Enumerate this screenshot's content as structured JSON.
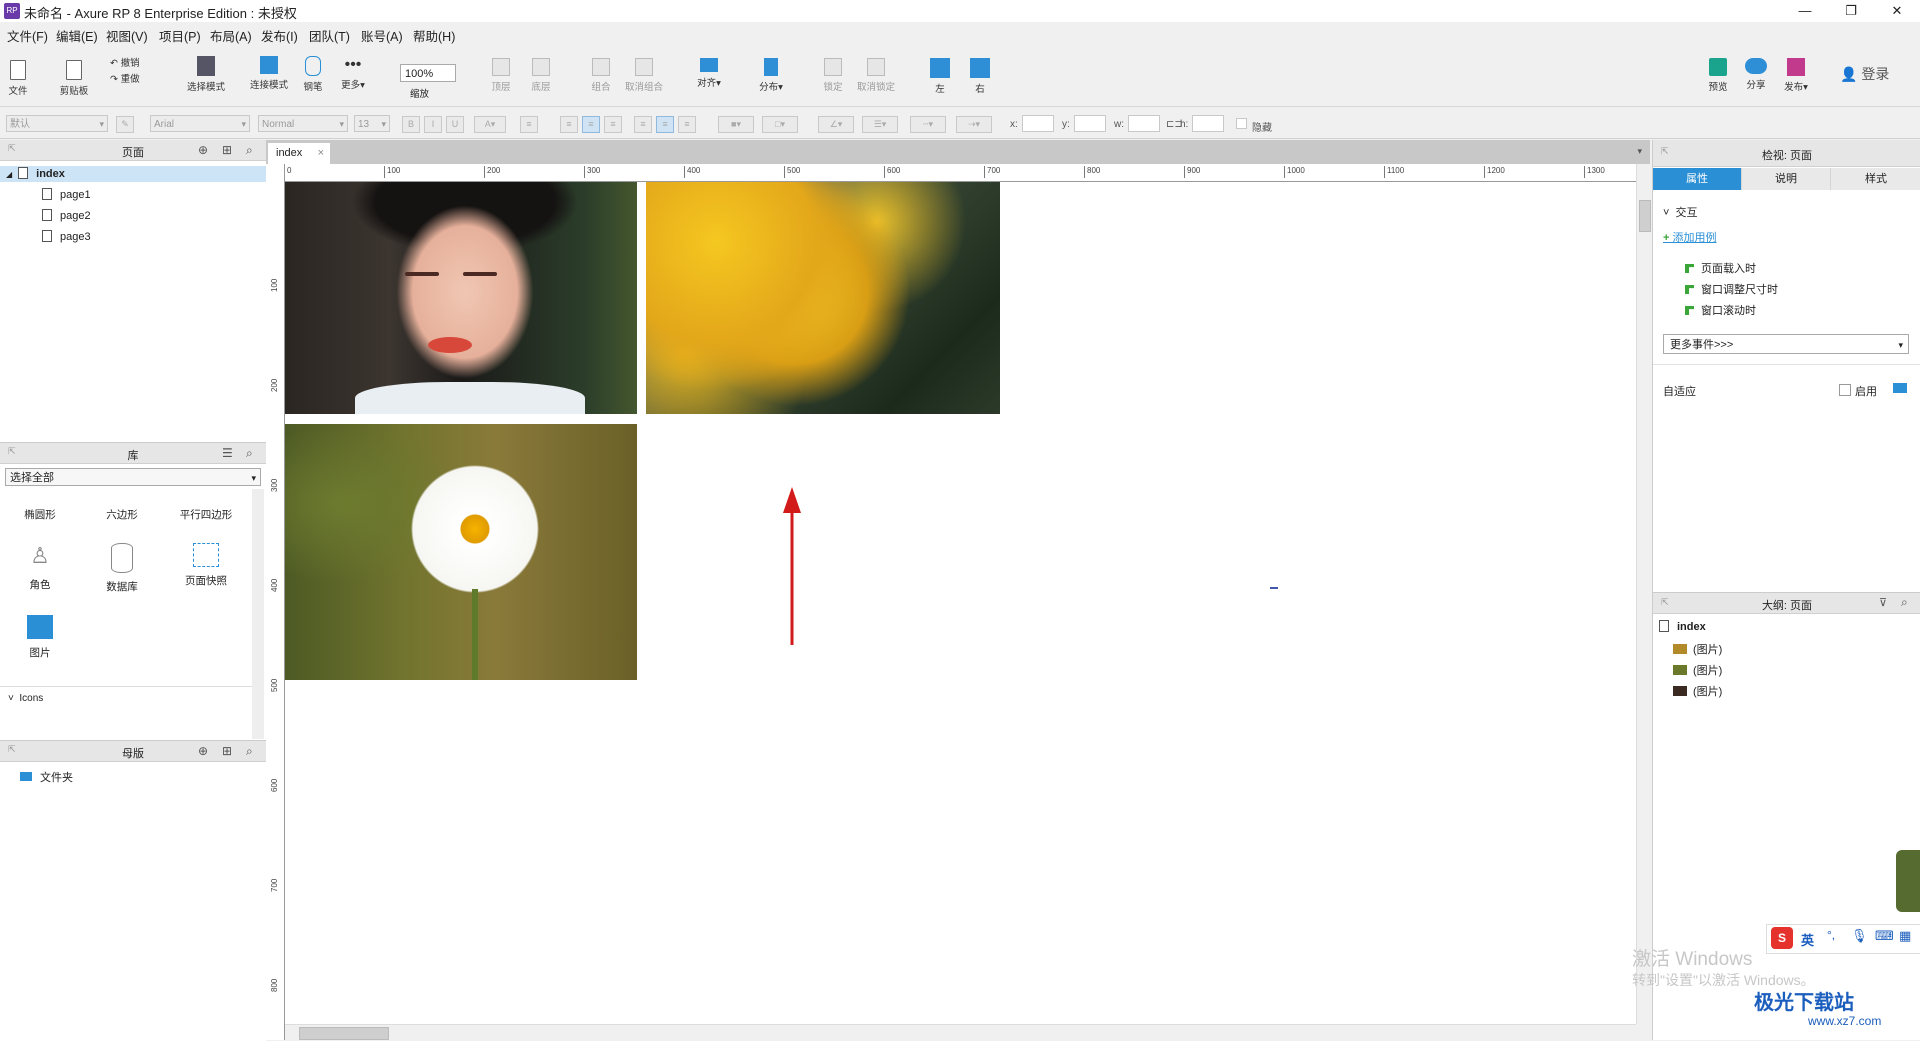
{
  "window": {
    "title": "未命名 - Axure RP 8 Enterprise Edition : 未授权",
    "app_icon": "RP"
  },
  "menu": [
    "文件(F)",
    "编辑(E)",
    "视图(V)",
    "项目(P)",
    "布局(A)",
    "发布(I)",
    "团队(T)",
    "账号(A)",
    "帮助(H)"
  ],
  "toolbar": {
    "file": "文件",
    "clipboard": "剪贴板",
    "undo": "撤销",
    "redo": "重做",
    "select_mode": "选择模式",
    "connect_mode": "连接模式",
    "pen": "钢笔",
    "more": "更多▾",
    "zoom_value": "100%",
    "zoom_label": "缩放",
    "top": "顶层",
    "bottom": "底层",
    "group": "组合",
    "ungroup": "取消组合",
    "align": "对齐▾",
    "distribute": "分布▾",
    "lock": "锁定",
    "unlock": "取消锁定",
    "left": "左",
    "right": "右",
    "preview": "预览",
    "share": "分享",
    "publish": "发布▾",
    "login": "登录"
  },
  "format": {
    "style": "默认",
    "font": "Arial",
    "weight": "Normal",
    "size": "13",
    "x_label": "x:",
    "y_label": "y:",
    "w_label": "w:",
    "h_label": "h:",
    "hidden_label": "隐藏"
  },
  "pages_panel": {
    "title": "页面",
    "root": "index",
    "pages": [
      "page1",
      "page2",
      "page3"
    ]
  },
  "library_panel": {
    "title": "库",
    "selector": "选择全部",
    "row1": [
      "椭圆形",
      "六边形",
      "平行四边形"
    ],
    "row2": [
      "角色",
      "数据库",
      "页面快照"
    ],
    "row3": [
      "图片"
    ],
    "section": "Icons"
  },
  "masters_panel": {
    "title": "母版",
    "folder": "文件夹"
  },
  "canvas": {
    "tab": "index",
    "hruler": [
      "0",
      "100",
      "200",
      "300",
      "400",
      "500",
      "600",
      "700",
      "800",
      "900",
      "1000",
      "1100",
      "1200",
      "1300"
    ],
    "vruler": [
      "100",
      "200",
      "300",
      "400",
      "500",
      "600",
      "700",
      "800"
    ]
  },
  "inspector": {
    "title": "检视: 页面",
    "tabs": [
      "属性",
      "说明",
      "样式"
    ],
    "interaction": "交互",
    "add_case": "添加用例",
    "events": [
      "页面载入时",
      "窗口调整尺寸时",
      "窗口滚动时"
    ],
    "more_events": "更多事件>>>",
    "adaptive": "自适应",
    "enable": "启用"
  },
  "outline": {
    "title": "大纲: 页面",
    "root": "index",
    "items": [
      "(图片)",
      "(图片)",
      "(图片)"
    ]
  },
  "overlay": {
    "watermark1": "激活 Windows",
    "watermark2": "转到\"设置\"以激活 Windows。",
    "logo": "极光下载站",
    "logo_url": "www.xz7.com",
    "ime_label": "英"
  }
}
